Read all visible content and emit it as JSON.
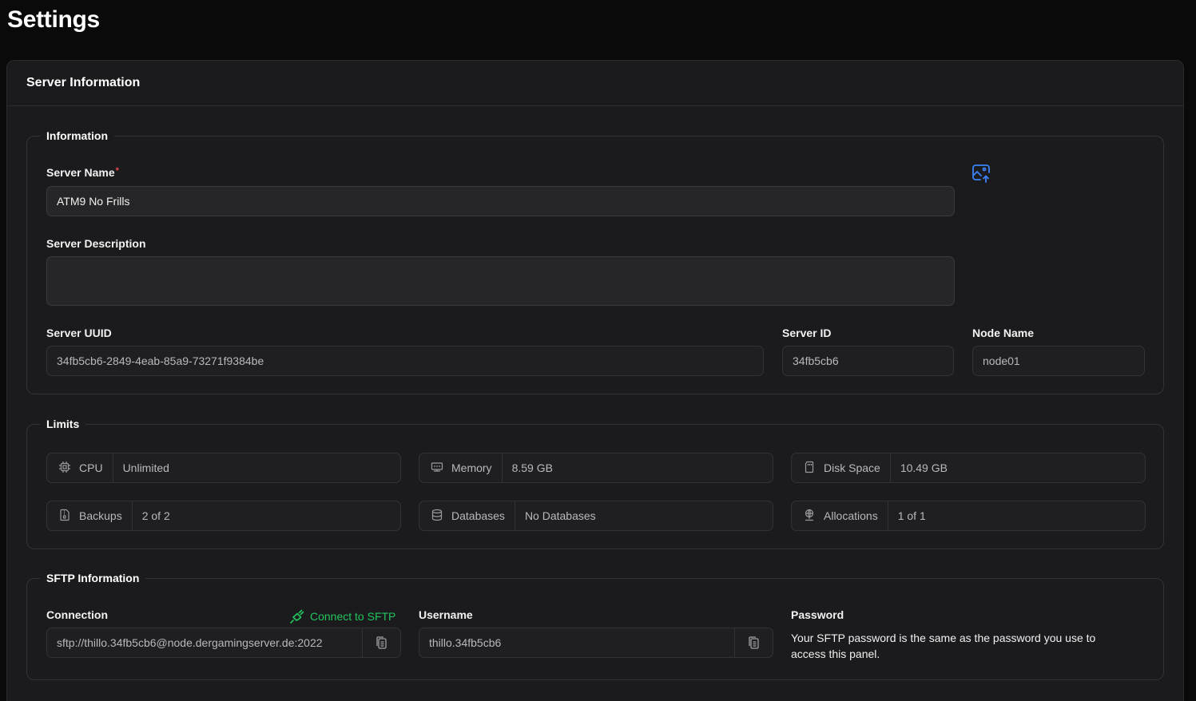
{
  "page": {
    "title": "Settings"
  },
  "card": {
    "title": "Server Information"
  },
  "information": {
    "legend": "Information",
    "server_name_label": "Server Name",
    "required_mark": "*",
    "server_name_value": "ATM9 No Frills",
    "server_description_label": "Server Description",
    "server_description_value": "",
    "uuid_label": "Server UUID",
    "uuid_value": "34fb5cb6-2849-4eab-85a9-73271f9384be",
    "id_label": "Server ID",
    "id_value": "34fb5cb6",
    "node_label": "Node Name",
    "node_value": "node01",
    "image_upload_icon": "image-upload-icon"
  },
  "limits": {
    "legend": "Limits",
    "items": [
      {
        "icon": "cpu-icon",
        "key": "CPU",
        "value": "Unlimited"
      },
      {
        "icon": "memory-icon",
        "key": "Memory",
        "value": "8.59 GB"
      },
      {
        "icon": "disk-icon",
        "key": "Disk Space",
        "value": "10.49 GB"
      },
      {
        "icon": "backup-icon",
        "key": "Backups",
        "value": "2 of 2"
      },
      {
        "icon": "database-icon",
        "key": "Databases",
        "value": "No Databases"
      },
      {
        "icon": "network-icon",
        "key": "Allocations",
        "value": "1 of 1"
      }
    ]
  },
  "sftp": {
    "legend": "SFTP Information",
    "connection_label": "Connection",
    "connect_link": "Connect to SFTP",
    "connection_value": "sftp://thillo.34fb5cb6@node.dergamingserver.de:2022",
    "username_label": "Username",
    "username_value": "thillo.34fb5cb6",
    "password_label": "Password",
    "password_note": "Your SFTP password is the same as the password you use to access this panel."
  },
  "colors": {
    "accent_green": "#22c55e",
    "accent_blue": "#3b82f6",
    "required": "#e5484d"
  }
}
